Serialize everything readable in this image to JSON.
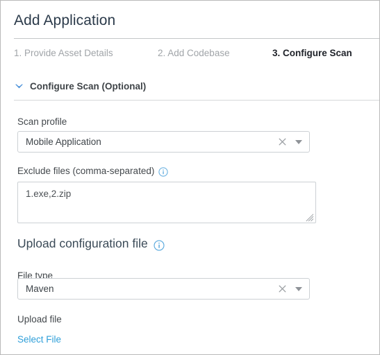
{
  "window": {
    "title": "Add Application"
  },
  "steps": [
    {
      "label": "1. Provide Asset Details",
      "state": "inactive"
    },
    {
      "label": "2. Add Codebase",
      "state": "inactive"
    },
    {
      "label": "3. Configure Scan",
      "state": "active"
    }
  ],
  "section": {
    "toggle_icon": "chevron-down-icon",
    "title": "Configure Scan (Optional)",
    "expanded": true
  },
  "form": {
    "scan_profile": {
      "label": "Scan profile",
      "value": "Mobile Application",
      "clear_icon": "close-icon",
      "caret_icon": "chevron-down-icon"
    },
    "exclude_files": {
      "label": "Exclude files (comma-separated)",
      "info_icon": "info-icon",
      "value": "1.exe,2.zip",
      "placeholder": ""
    },
    "upload_configuration_file": {
      "heading": "Upload configuration file",
      "info_icon": "info-icon"
    },
    "file_type": {
      "label": "File type",
      "value": "Maven",
      "clear_icon": "close-icon",
      "caret_icon": "chevron-down-icon"
    },
    "upload_file": {
      "label": "Upload file",
      "link_label": "Select File"
    }
  },
  "colors": {
    "title": "#2b3a4a",
    "active_step": "#20232a",
    "inactive_step": "#a0a4a8",
    "accent_blue": "#4a90d9",
    "link_blue": "#2f9fd9",
    "info_blue": "#5aa9dd",
    "border": "#ccd0d4"
  }
}
